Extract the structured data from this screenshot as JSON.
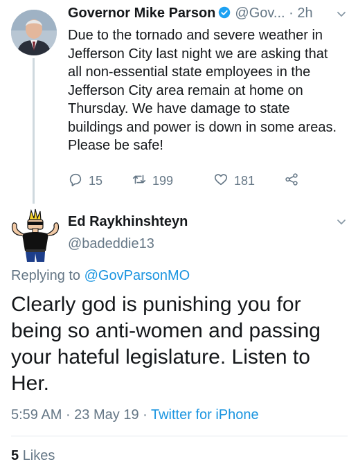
{
  "parent_tweet": {
    "display_name": "Governor Mike Parson",
    "handle": "@Gov...",
    "time": "2h",
    "text": "Due to the tornado and severe weather in Jefferson City last night we are asking that all non-essential state employees in the Jefferson City area remain at home on Thursday. We have damage to state buildings and power is down in some areas. Please be safe!",
    "replies": "15",
    "retweets": "199",
    "likes": "181",
    "verified_color": "#1da1f2"
  },
  "reply_tweet": {
    "display_name": "Ed Raykhinshteyn",
    "handle": "@badeddie13",
    "replying_prefix": "Replying to",
    "replying_mention": "@GovParsonMO",
    "text": "Clearly god is punishing you for being so anti-women and passing your hateful legislature.  Listen to Her.",
    "time": "5:59 AM",
    "date": "23 May 19",
    "source": "Twitter for iPhone",
    "likes_count": "5",
    "likes_label": "Likes"
  },
  "colors": {
    "link": "#1b95e0",
    "secondary": "#657786",
    "text": "#14171a"
  },
  "icons": [
    "verified-icon",
    "chevron-down-icon",
    "reply-icon",
    "retweet-icon",
    "like-icon",
    "share-icon"
  ]
}
